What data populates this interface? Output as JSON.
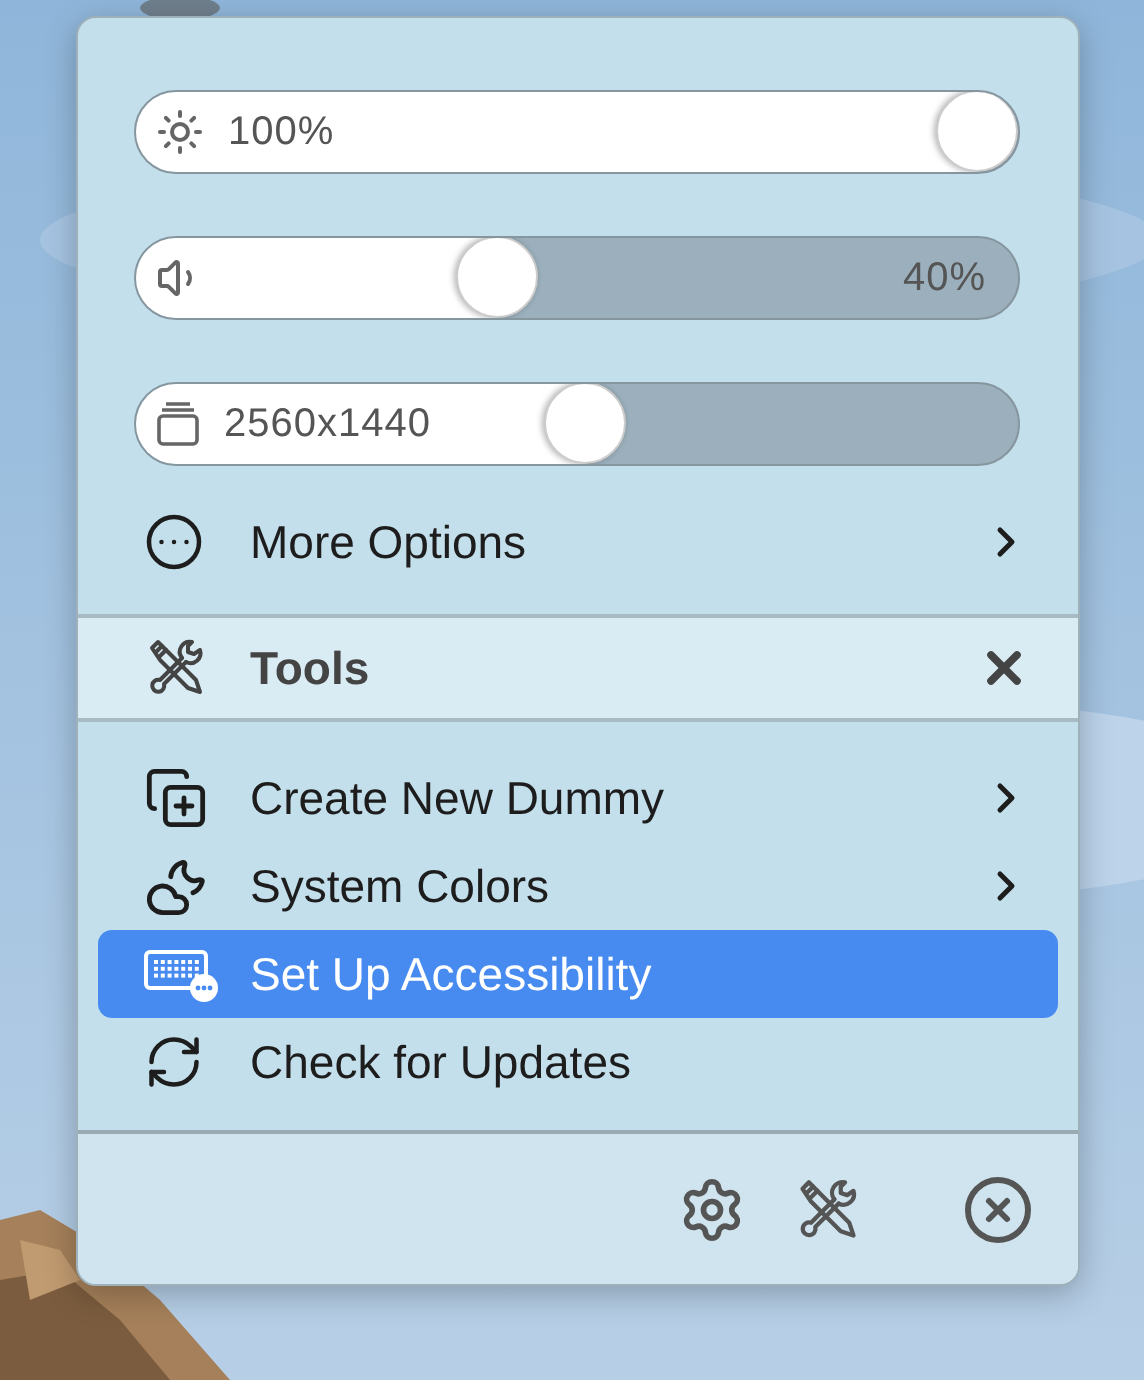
{
  "sliders": [
    {
      "kind": "brightness",
      "reading": "100%",
      "level": 1
    },
    {
      "kind": "volume",
      "reading": "40%",
      "level": 0.4
    },
    {
      "kind": "resolution",
      "reading": "2560x1440",
      "level": 0.51
    }
  ],
  "more_options": {
    "label": "More Options",
    "submenu": true
  },
  "section": {
    "title": "Tools"
  },
  "items": [
    {
      "kind": "dummy",
      "label": "Create New Dummy",
      "submenu": true,
      "selected": false
    },
    {
      "kind": "colors",
      "label": "System Colors",
      "submenu": true,
      "selected": false
    },
    {
      "kind": "accessibility",
      "label": "Set Up Accessibility",
      "submenu": false,
      "selected": true
    },
    {
      "kind": "updates",
      "label": "Check for Updates",
      "submenu": false,
      "selected": false
    }
  ],
  "footer_buttons": [
    {
      "kind": "settings"
    },
    {
      "kind": "tools"
    },
    {
      "kind": "quit"
    }
  ]
}
